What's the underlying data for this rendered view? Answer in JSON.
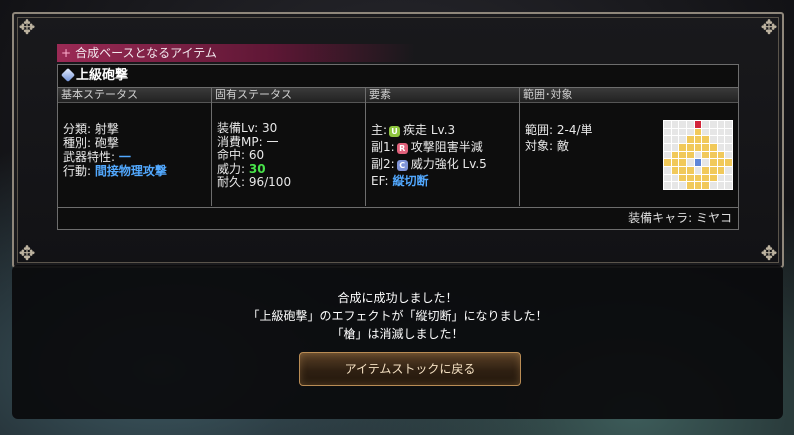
{
  "item": {
    "header": "合成ベースとなるアイテム",
    "name": "上級砲撃",
    "columns": {
      "basic": "基本ステータス",
      "unique": "固有ステータス",
      "element": "要素",
      "range": "範囲･対象"
    },
    "basic": {
      "category": "分類: 射撃",
      "type": "種別: 砲撃",
      "weapon_trait_label": "武器特性:",
      "weapon_trait_value": "一",
      "action_label": "行動:",
      "action_value": "間接物理攻撃"
    },
    "unique": {
      "equip_lv": "装備Lv: 30",
      "mp_cost": "消費MP: 一",
      "accuracy": "命中: 60",
      "power_label": "威力:",
      "power_value": "30",
      "durability": "耐久: 96/100"
    },
    "element": {
      "main_label": "主:",
      "main_badge": "U",
      "main_value": "疾走 Lv.3",
      "sub1_label": "副1:",
      "sub1_badge": "R",
      "sub1_value": "攻撃阻害半減",
      "sub2_label": "副2:",
      "sub2_badge": "C",
      "sub2_value": "威力強化 Lv.5",
      "ef_label": "EF:",
      "ef_value": "縦切断"
    },
    "range": {
      "range": "範囲: 2-4/単",
      "target": "対象: 敵"
    },
    "equip_character": "装備キャラ: ミヤコ"
  },
  "dialog": {
    "line1": "合成に成功しました！",
    "line2": "「上級砲撃」のエフェクトが「縦切断」になりました！",
    "line3": "「槍」は消滅しました！",
    "button": "アイテムストックに戻る"
  },
  "colors": {
    "effect_blue": "#52a9ff",
    "power_green": "#48e34a",
    "header_magenta": "#9b2a55",
    "range_yellow": "#f1c95a",
    "target_red": "#d2243a",
    "origin_blue": "#5e86d9"
  },
  "icons": [
    "plus-icon",
    "item-pen-icon",
    "rarity-u-icon",
    "rarity-r-icon",
    "rarity-c-icon",
    "corner-ornament-icon"
  ]
}
